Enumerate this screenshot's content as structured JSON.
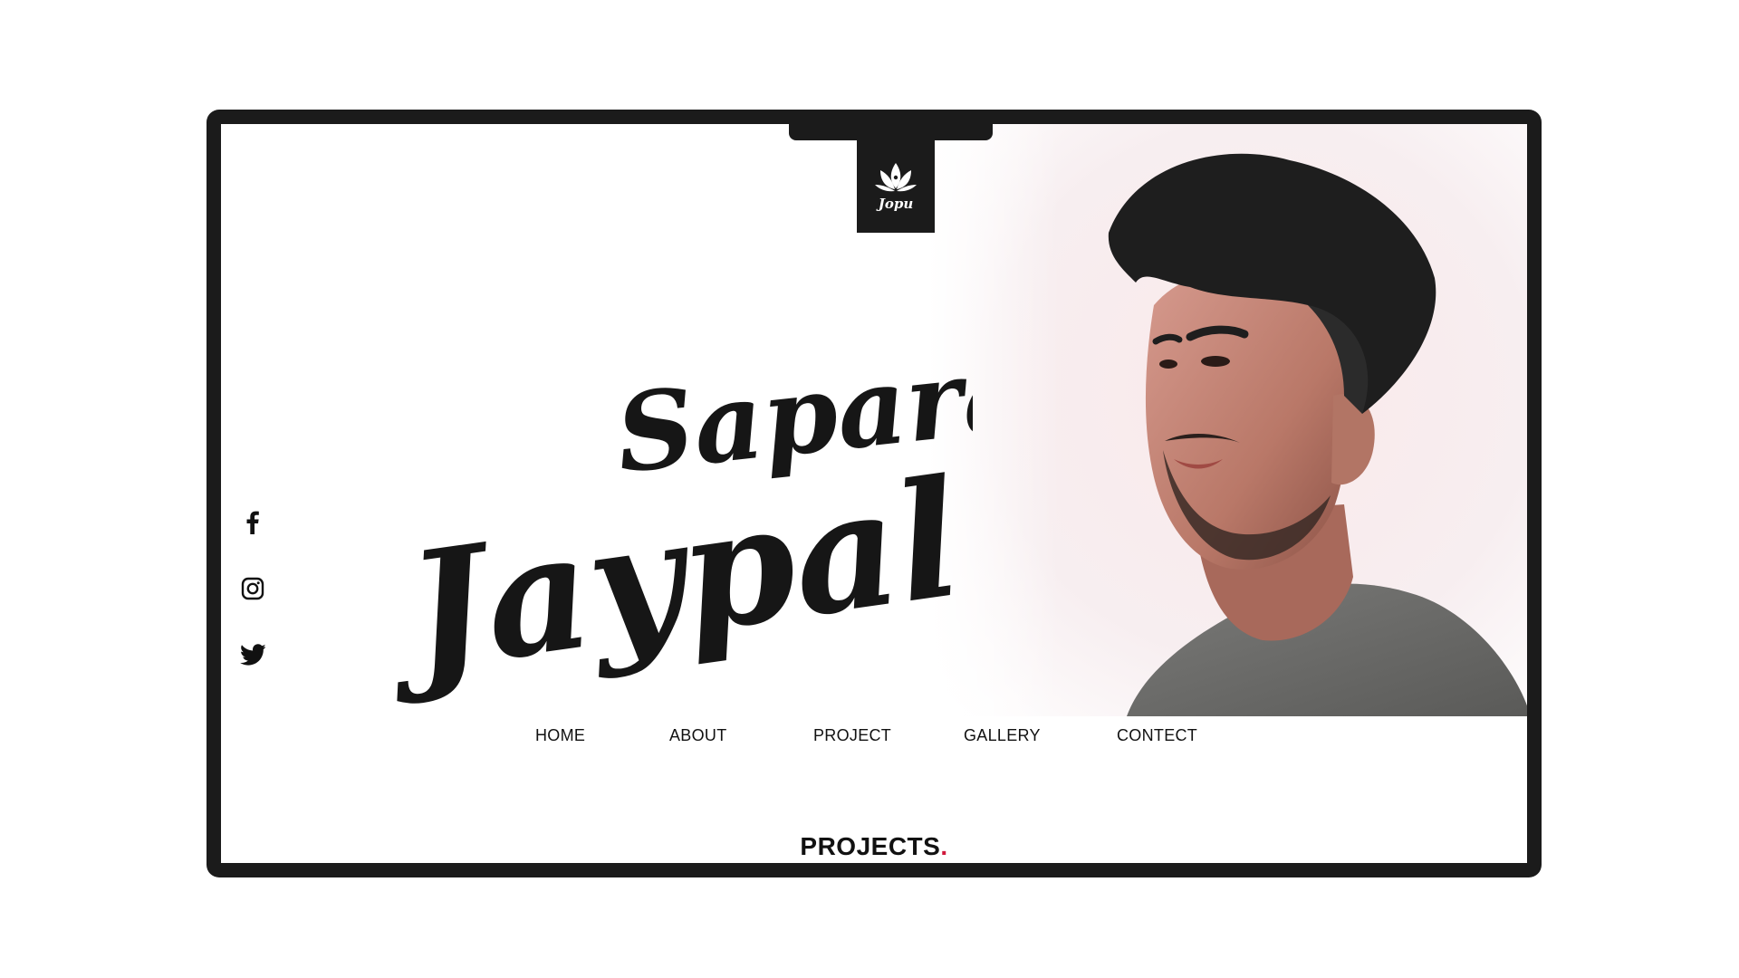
{
  "logo": {
    "icon": "lotus-logo-icon",
    "text": "Jopu"
  },
  "hero": {
    "first_name": "Sapara",
    "last_name": "Jaypal",
    "photo_icon": "portrait-photo"
  },
  "social": [
    {
      "icon": "facebook-icon"
    },
    {
      "icon": "instagram-icon"
    },
    {
      "icon": "twitter-icon"
    }
  ],
  "nav": {
    "items": [
      {
        "label": "HOME"
      },
      {
        "label": "ABOUT"
      },
      {
        "label": "PROJECT"
      },
      {
        "label": "GALLERY"
      },
      {
        "label": "CONTECT"
      }
    ]
  },
  "projects": {
    "heading": "PROJECTS",
    "dot": "."
  },
  "colors": {
    "frame": "#1b1b1b",
    "accent": "#d0183b",
    "background": "#ffffff"
  }
}
